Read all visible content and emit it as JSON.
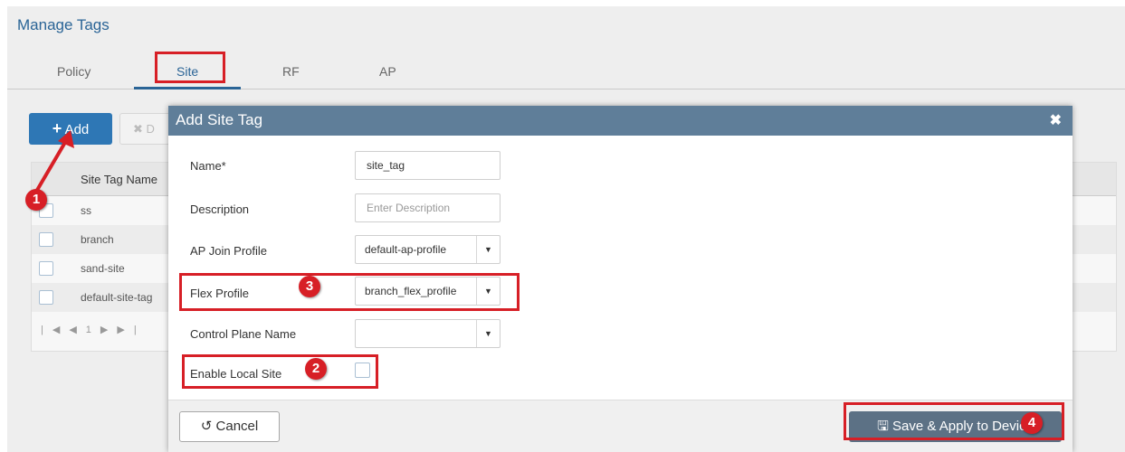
{
  "page": {
    "title": "Manage Tags",
    "tabs": [
      {
        "label": "Policy"
      },
      {
        "label": "Site"
      },
      {
        "label": "RF"
      },
      {
        "label": "AP"
      }
    ],
    "add_label": "Add",
    "delete_label": "D",
    "grid": {
      "column_header": "Site Tag Name",
      "rows": [
        "ss",
        "branch",
        "sand-site",
        "default-site-tag"
      ],
      "pager": "1"
    }
  },
  "modal": {
    "title": "Add Site Tag",
    "fields": {
      "name_label": "Name*",
      "name_value": "site_tag",
      "description_label": "Description",
      "description_placeholder": "Enter Description",
      "ap_join_label": "AP Join Profile",
      "ap_join_value": "default-ap-profile",
      "flex_label": "Flex Profile",
      "flex_value": "branch_flex_profile",
      "control_plane_label": "Control Plane Name",
      "control_plane_value": "",
      "local_site_label": "Enable Local Site"
    },
    "cancel_label": "Cancel",
    "save_label": "Save & Apply to Device"
  },
  "annotations": [
    "1",
    "2",
    "3",
    "4"
  ],
  "colors": {
    "accent": "#2a6496",
    "modal_header": "#5f7e99",
    "annotation_red": "#d71f26",
    "save_button": "#5c7185"
  }
}
